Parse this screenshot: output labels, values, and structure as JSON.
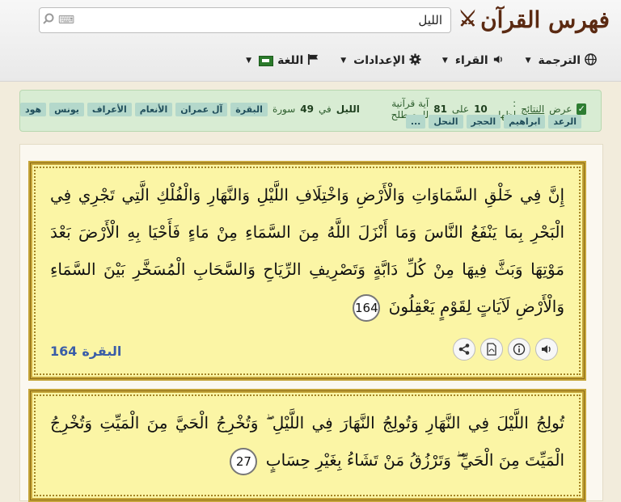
{
  "app": {
    "title": "فهرس القرآن"
  },
  "search": {
    "value": "الليل"
  },
  "nav": [
    {
      "label": "الترجمة",
      "icon": "globe-icon"
    },
    {
      "label": "القراء",
      "icon": "speaker-icon"
    },
    {
      "label": "الإعدادات",
      "icon": "gear-icon"
    },
    {
      "label": "اللغة",
      "icon": "flag-icon"
    }
  ],
  "results": {
    "prefix": "عرض",
    "results_word": "النتائج",
    "showing": ": إظهار",
    "shown_count": "10",
    "of_word": "على",
    "total_count": "81",
    "phrase": "آية قرآنية للمصطلح",
    "term": "الليل",
    "in_word": "في",
    "surah_count": "49",
    "surah_word": "سورة",
    "surahs_row1": [
      "البقرة",
      "آل عمران",
      "الأنعام",
      "الأعراف",
      "يونس",
      "هود"
    ],
    "surahs_row2": [
      "الرعد",
      "ابراهيم",
      "الحجر",
      "النحل",
      "..."
    ]
  },
  "verses": [
    {
      "text": "إِنَّ فِي خَلْقِ السَّمَاوَاتِ وَالْأَرْضِ وَاخْتِلَافِ اللَّيْلِ وَالنَّهَارِ وَالْفُلْكِ الَّتِي تَجْرِي فِي الْبَحْرِ بِمَا يَنْفَعُ النَّاسَ وَمَا أَنْزَلَ اللَّهُ مِنَ السَّمَاءِ مِنْ مَاءٍ فَأَحْيَا بِهِ الْأَرْضَ بَعْدَ مَوْتِهَا وَبَثَّ فِيهَا مِنْ كُلِّ دَابَّةٍ وَتَصْرِيفِ الرِّيَاحِ وَالسَّحَابِ الْمُسَخَّرِ بَيْنَ السَّمَاءِ وَالْأَرْضِ لَآيَاتٍ لِقَوْمٍ يَعْقِلُونَ",
      "number": "164",
      "surah": "البقرة",
      "ref_number": "164"
    },
    {
      "text": "تُولِجُ اللَّيْلَ فِي النَّهَارِ وَتُولِجُ النَّهَارَ فِي اللَّيْلِ ۖ وَتُخْرِجُ الْحَيَّ مِنَ الْمَيِّتِ وَتُخْرِجُ الْمَيِّتَ مِنَ الْحَيِّ ۖ وَتَرْزُقُ مَنْ تَشَاءُ بِغَيْرِ حِسَابٍ",
      "number": "27"
    }
  ],
  "tools": [
    "share-icon",
    "pdf-icon",
    "info-icon",
    "audio-icon"
  ],
  "colors": {
    "brand": "#5b2a12",
    "card_bg": "#fbf5a5",
    "border": "#c6a53a",
    "ref": "#3a5da8",
    "alert_bg": "#d8ecd3"
  }
}
